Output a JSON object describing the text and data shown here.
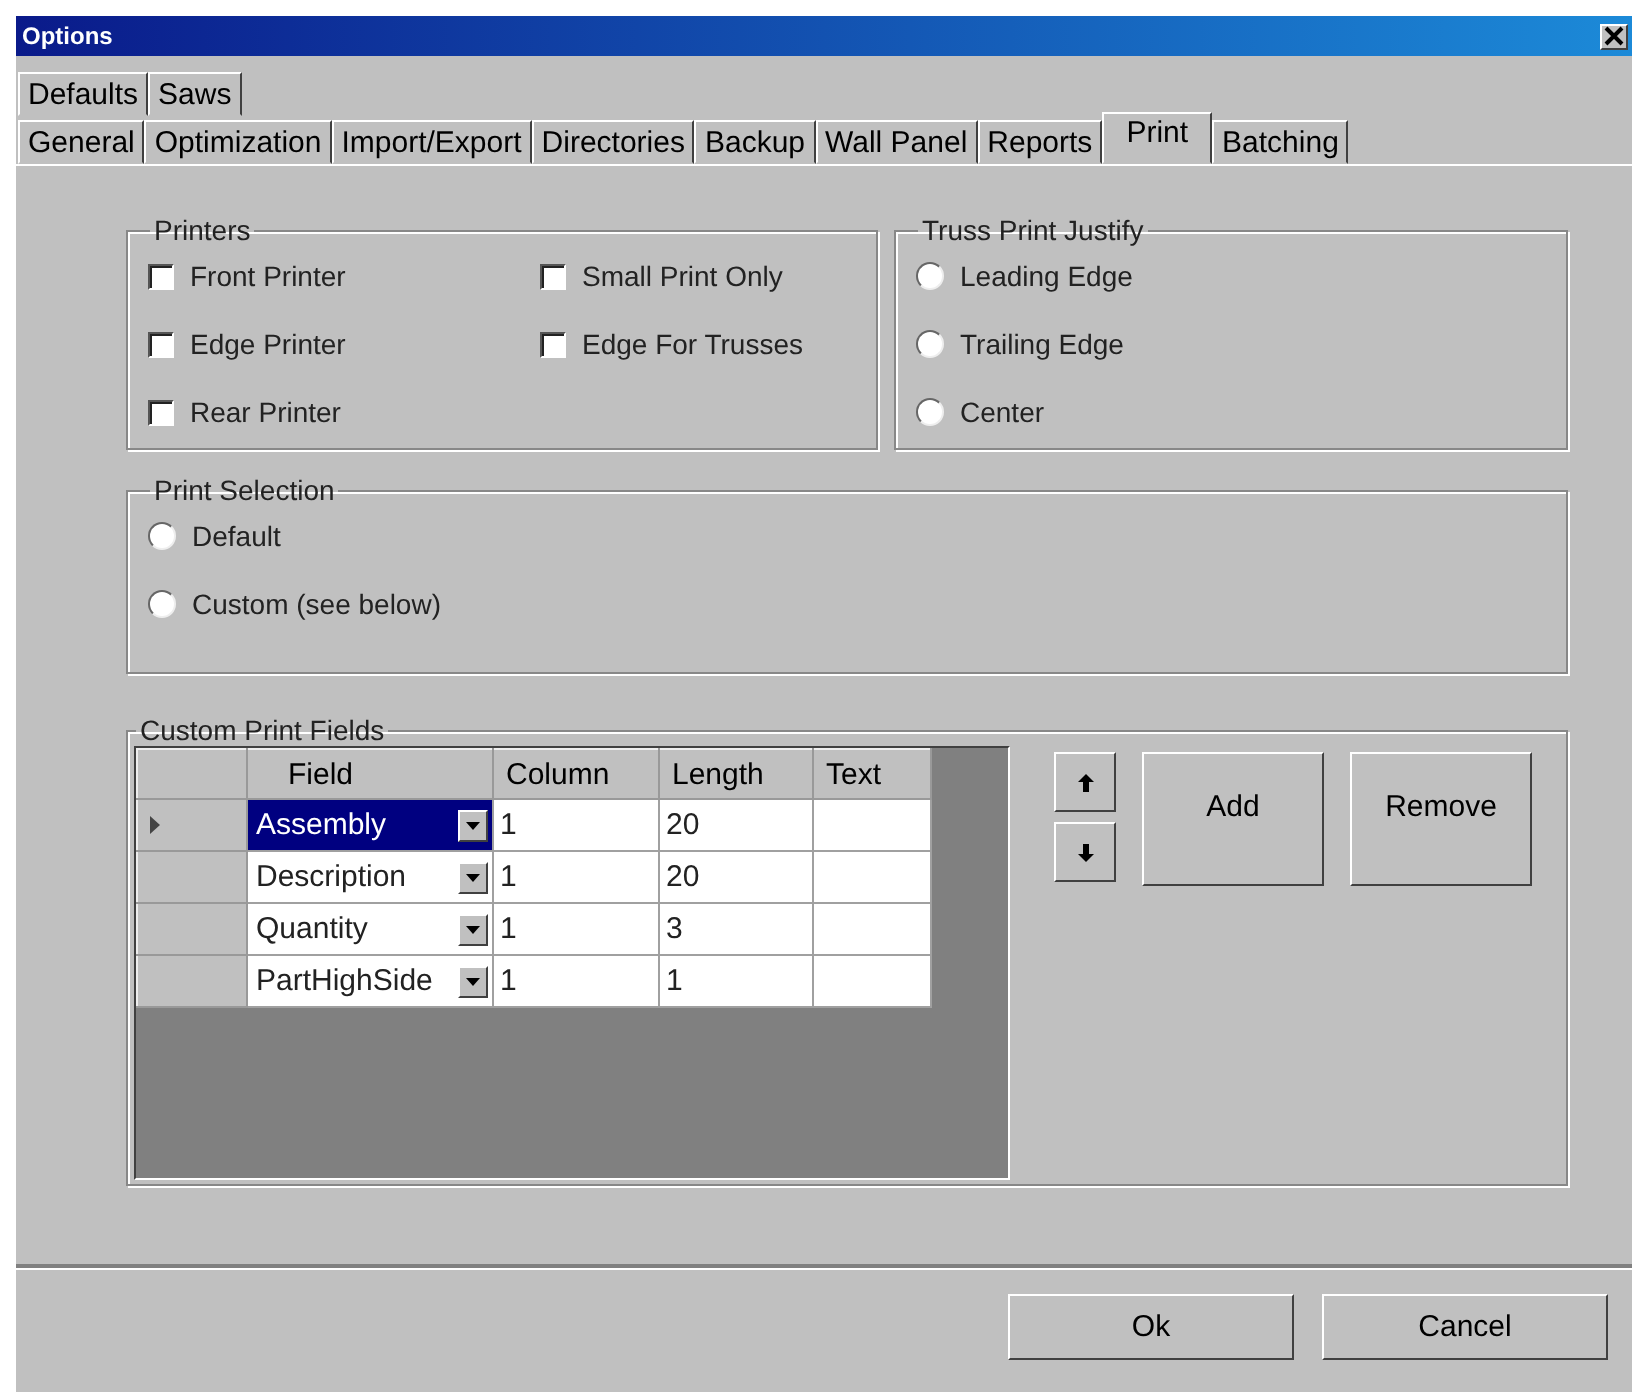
{
  "window": {
    "title": "Options"
  },
  "tab_rows": [
    [
      {
        "label": "Defaults",
        "selected": false
      },
      {
        "label": "Saws",
        "selected": false
      }
    ],
    [
      {
        "label": "General",
        "selected": false
      },
      {
        "label": "Optimization",
        "selected": false
      },
      {
        "label": "Import/Export",
        "selected": false
      },
      {
        "label": "Directories",
        "selected": false
      },
      {
        "label": "Backup",
        "selected": false
      },
      {
        "label": "Wall Panel",
        "selected": false
      },
      {
        "label": "Reports",
        "selected": false
      },
      {
        "label": "Print",
        "selected": true
      },
      {
        "label": "Batching",
        "selected": false
      }
    ]
  ],
  "printers": {
    "title": "Printers",
    "options": [
      {
        "label": "Front Printer",
        "checked": false
      },
      {
        "label": "Edge Printer",
        "checked": false
      },
      {
        "label": "Rear Printer",
        "checked": false
      },
      {
        "label": "Small Print Only",
        "checked": false
      },
      {
        "label": "Edge For Trusses",
        "checked": false
      }
    ]
  },
  "truss_print_justify": {
    "title": "Truss Print Justify",
    "options": [
      {
        "label": "Leading Edge",
        "selected": false
      },
      {
        "label": "Trailing Edge",
        "selected": false
      },
      {
        "label": "Center",
        "selected": false
      }
    ]
  },
  "print_selection": {
    "title": "Print Selection",
    "options": [
      {
        "label": "Default",
        "selected": false
      },
      {
        "label": "Custom (see below)",
        "selected": false
      }
    ]
  },
  "custom_print_fields": {
    "title": "Custom Print Fields",
    "table": {
      "columns": [
        "Field",
        "Column",
        "Length",
        "Text"
      ],
      "rows": [
        {
          "field": "Assembly",
          "column": "1",
          "length": "20",
          "selected": true
        },
        {
          "field": "Description",
          "column": "1",
          "length": "20",
          "selected": false
        },
        {
          "field": "Quantity",
          "column": "1",
          "length": "3",
          "selected": false
        },
        {
          "field": "PartHighSide",
          "column": "1",
          "length": "1",
          "selected": false
        }
      ]
    },
    "buttons": [
      "Add",
      "Remove"
    ]
  },
  "footer_buttons": [
    "Ok",
    "Cancel"
  ]
}
